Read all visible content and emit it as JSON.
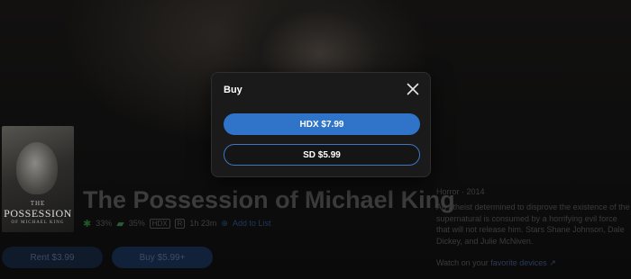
{
  "movie": {
    "title": "The Possession of Michael King",
    "poster_title_small": "THE",
    "poster_title": "POSSESSION",
    "poster_subtitle": "OF MICHAEL KING",
    "tomatometer": "33%",
    "audience_score": "35%",
    "quality_badge": "HDX",
    "rating_badge": "R",
    "runtime": "1h 23m",
    "add_to_list": "Add to List",
    "genre": "Horror",
    "year": "2014",
    "synopsis": "An atheist determined to disprove the existence of the supernatural is consumed by a horrifying evil force that will not release him. Stars Shane Johnson, Dale Dickey, and Julie McNiven.",
    "watch_on_prefix": "Watch on your",
    "watch_on_link": "favorite devices",
    "rent_label": "Rent $3.99",
    "buy_label": "Buy $5.99+"
  },
  "modal": {
    "title": "Buy",
    "options": [
      {
        "label": "HDX $7.99"
      },
      {
        "label": "SD $5.99"
      }
    ]
  },
  "icons": {
    "close": "close-icon",
    "tomato": "tomato-icon",
    "popcorn": "popcorn-icon",
    "add": "plus-circle-icon",
    "external": "external-link-icon"
  },
  "colors": {
    "accent": "#2f74c9",
    "modal_bg": "#1a1a1a",
    "page_bg": "#0b0b0b"
  }
}
